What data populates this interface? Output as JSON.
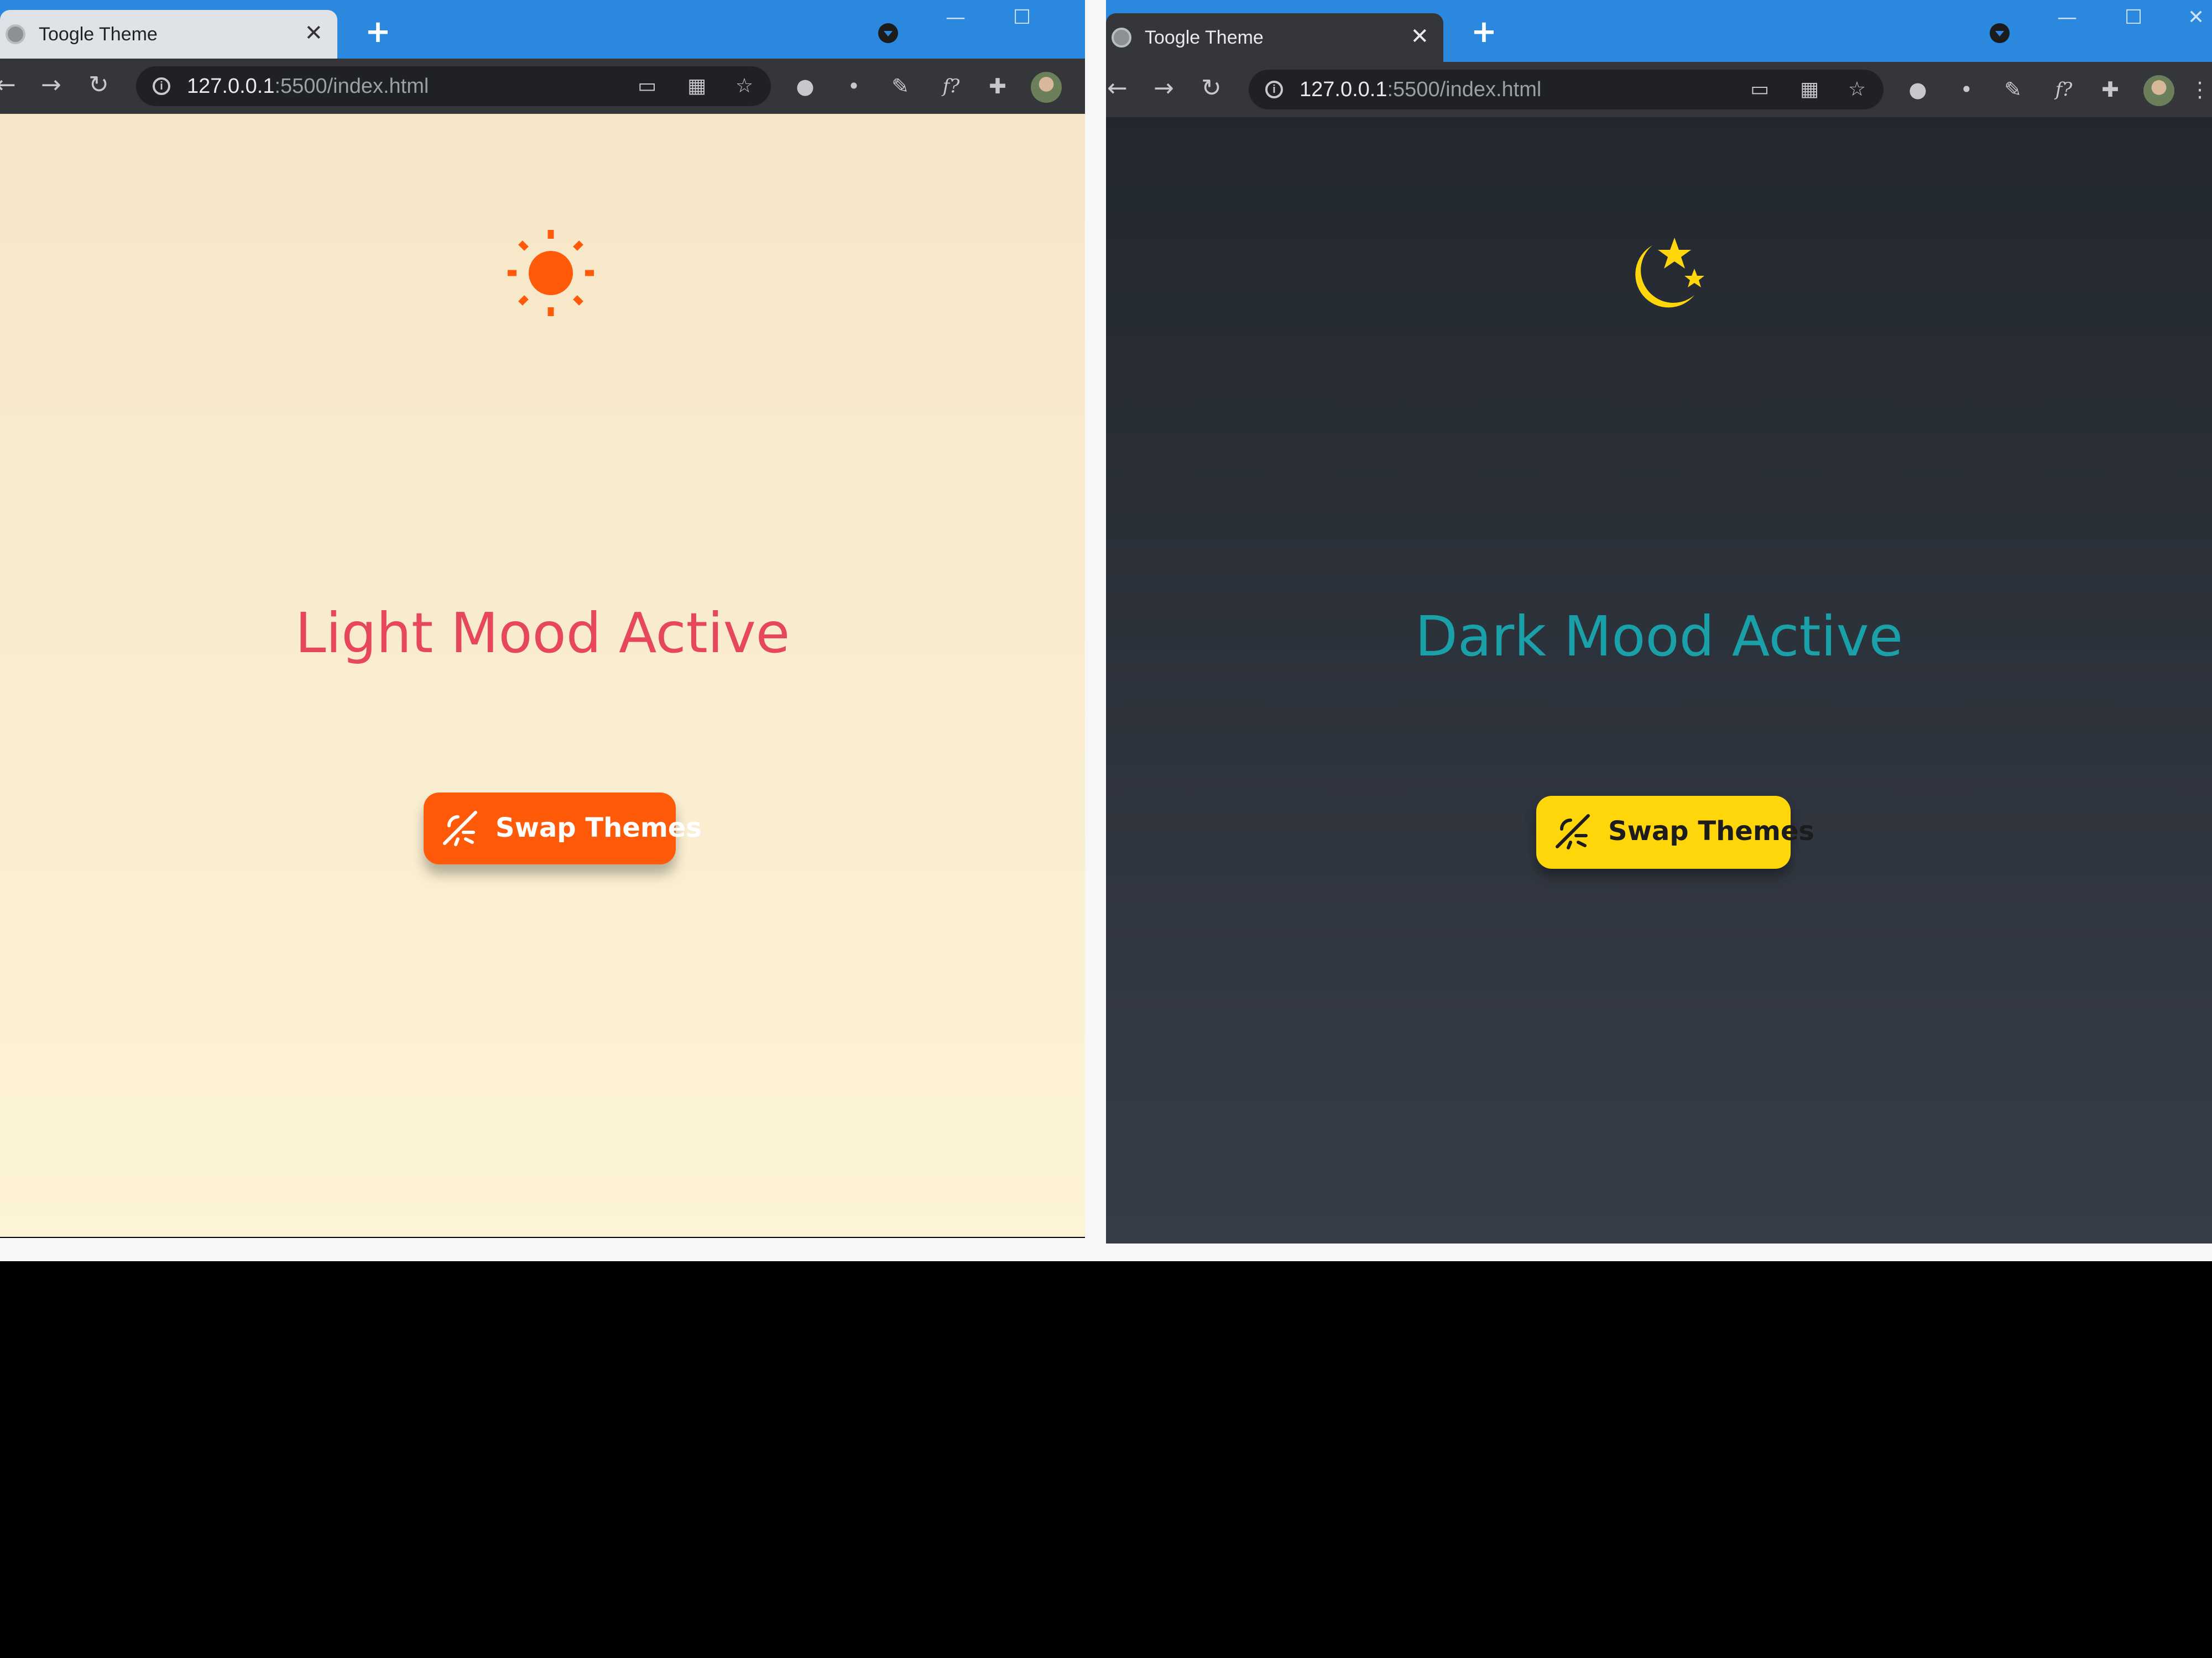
{
  "light": {
    "tab_title": "Toogle Theme",
    "url_host": "127.0.0.1",
    "url_rest": ":5500/index.html",
    "mood_text": "Light Mood Active",
    "button_label": "Swap Themes",
    "icon": "sun-icon",
    "colors": {
      "accent": "#ff5a0a",
      "text": "#e6475b",
      "bg_top": "#f6e6c8",
      "bg_bottom": "#fdf3d6"
    }
  },
  "dark": {
    "tab_title": "Toogle Theme",
    "url_host": "127.0.0.1",
    "url_rest": ":5500/index.html",
    "mood_text": "Dark Mood Active",
    "button_label": "Swap Themes",
    "icon": "moon-stars-icon",
    "colors": {
      "accent": "#ffd60a",
      "text": "#1aa0a8",
      "bg_top": "#232830",
      "bg_bottom": "#373d47"
    }
  },
  "browser": {
    "close_glyph": "✕",
    "newtab_glyph": "+",
    "back_glyph": "←",
    "forward_glyph": "→",
    "reload_glyph": "↻",
    "star_glyph": "☆",
    "ext_f_glyph": "f?",
    "minimize_glyph": "—",
    "maximize_glyph": "☐",
    "close_window_glyph": "✕"
  }
}
